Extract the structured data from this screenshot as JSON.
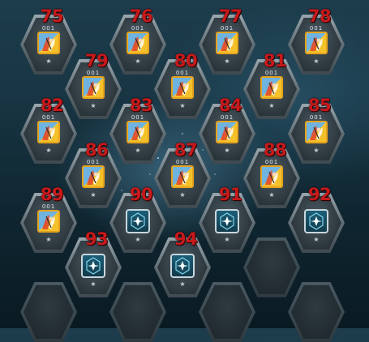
{
  "grid": {
    "slots": [
      {
        "number": "75",
        "code": "001",
        "rarity": "★",
        "type": "card"
      },
      {
        "number": "76",
        "code": "001",
        "rarity": "★",
        "type": "card"
      },
      {
        "number": "77",
        "code": "001",
        "rarity": "★",
        "type": "card"
      },
      {
        "number": "78",
        "code": "001",
        "rarity": "★",
        "type": "card"
      },
      {
        "number": "79",
        "code": "001",
        "rarity": "★",
        "type": "card"
      },
      {
        "number": "80",
        "code": "001",
        "rarity": "★",
        "type": "card"
      },
      {
        "number": "81",
        "code": "001",
        "rarity": "★",
        "type": "card"
      },
      {
        "number": "82",
        "code": "001",
        "rarity": "★",
        "type": "card"
      },
      {
        "number": "83",
        "code": "001",
        "rarity": "★",
        "type": "card"
      },
      {
        "number": "84",
        "code": "001",
        "rarity": "★",
        "type": "card"
      },
      {
        "number": "85",
        "code": "001",
        "rarity": "★",
        "type": "card"
      },
      {
        "number": "86",
        "code": "001",
        "rarity": "★",
        "type": "card"
      },
      {
        "number": "87",
        "code": "001",
        "rarity": "★",
        "type": "card"
      },
      {
        "number": "88",
        "code": "001",
        "rarity": "★",
        "type": "card"
      },
      {
        "number": "89",
        "code": "001",
        "rarity": "★",
        "type": "card"
      },
      {
        "number": "90",
        "code": "",
        "rarity": "★",
        "type": "chip"
      },
      {
        "number": "91",
        "code": "",
        "rarity": "★",
        "type": "chip"
      },
      {
        "number": "92",
        "code": "",
        "rarity": "★",
        "type": "chip"
      },
      {
        "number": "93",
        "code": "",
        "rarity": "★",
        "type": "chip"
      },
      {
        "number": "94",
        "code": "",
        "rarity": "★",
        "type": "chip"
      },
      {
        "number": "",
        "code": "",
        "rarity": "",
        "type": "empty"
      },
      {
        "number": "",
        "code": "",
        "rarity": "",
        "type": "empty"
      },
      {
        "number": "",
        "code": "",
        "rarity": "",
        "type": "empty"
      },
      {
        "number": "",
        "code": "",
        "rarity": "",
        "type": "empty"
      },
      {
        "number": "",
        "code": "",
        "rarity": "",
        "type": "empty"
      }
    ]
  },
  "colors": {
    "number_label": "#c8191b",
    "card_border": "#e6a21b",
    "chip_border": "#c9d6dc"
  },
  "icons": {
    "card": "character-card-icon",
    "chip": "crystal-chip-icon"
  }
}
